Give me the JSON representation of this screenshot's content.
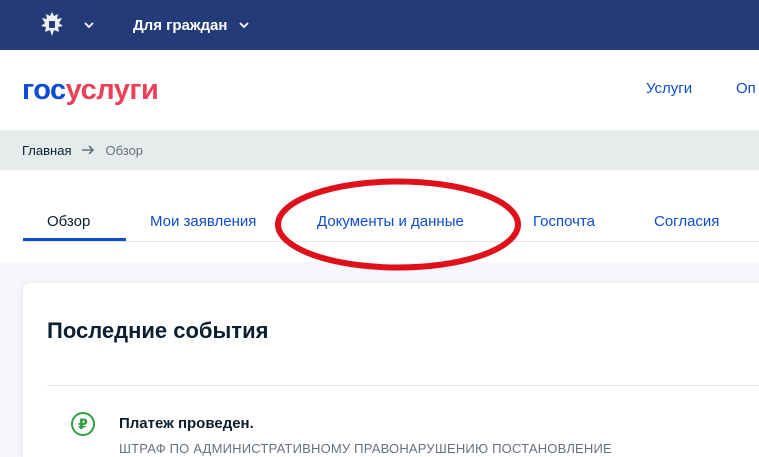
{
  "topbar": {
    "emblem_icon": "russia-coat-of-arms-icon",
    "emblem_dropdown_icon": "chevron-down-icon",
    "audience_label": "Для граждан",
    "audience_dropdown_icon": "chevron-down-icon",
    "background_color": "#243b7a"
  },
  "header": {
    "logo_part1": "гос",
    "logo_part2": "услуги",
    "nav": [
      "Услуги",
      "Оп"
    ],
    "logo_colors": {
      "gos": "#0d4cd3",
      "uslugi": "#ee3f58"
    }
  },
  "breadcrumb": {
    "home": "Главная",
    "separator_icon": "arrow-right-icon",
    "current": "Обзор"
  },
  "tabs": [
    {
      "label": "Обзор",
      "active": true
    },
    {
      "label": "Мои заявления",
      "active": false
    },
    {
      "label": "Документы и данные",
      "active": false
    },
    {
      "label": "Госпочта",
      "active": false
    },
    {
      "label": "Согласия",
      "active": false
    }
  ],
  "annotation": {
    "shape": "red-ellipse",
    "color": "#e0101a",
    "target": "Документы и данные"
  },
  "events": {
    "title": "Последние события",
    "items": [
      {
        "icon": "ruble-icon",
        "title": "Платеж проведен.",
        "description": "ШТРАФ ПО АДМИНИСТРАТИВНОМУ ПРАВОНАРУШЕНИЮ ПОСТАНОВЛЕНИЕ"
      }
    ]
  },
  "colors": {
    "accent": "#0d4cd3",
    "text": "#0b1f33",
    "muted": "#66727f",
    "success": "#2f9e44"
  }
}
